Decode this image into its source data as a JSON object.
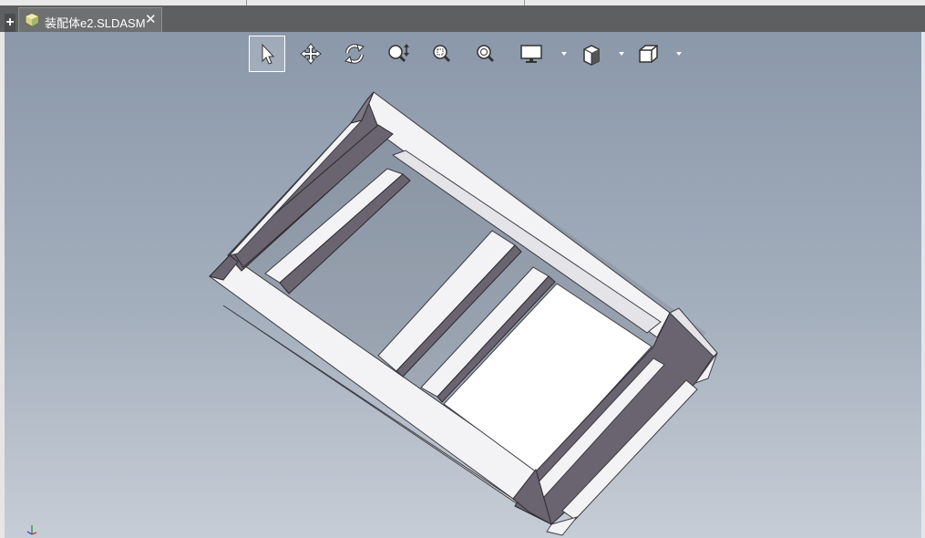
{
  "tabs": {
    "add_label": "+",
    "document": {
      "title": "装配体e2.SLDASM",
      "close_label": "✕",
      "icon": "assembly-icon"
    }
  },
  "toolbar": {
    "items": [
      {
        "name": "select",
        "icon": "pointer-icon",
        "active": true
      },
      {
        "name": "pan",
        "icon": "move-arrows-icon",
        "active": false
      },
      {
        "name": "rotate",
        "icon": "rotate-icon",
        "active": false
      },
      {
        "name": "zoom-in-out",
        "icon": "zoom-in-out-icon",
        "active": false
      },
      {
        "name": "zoom-to-area",
        "icon": "zoom-to-area-icon",
        "active": false
      },
      {
        "name": "zoom-to-fit",
        "icon": "zoom-to-fit-icon",
        "active": false
      },
      {
        "name": "display-style",
        "icon": "monitor-icon",
        "has_dropdown": true
      },
      {
        "name": "hide-show-items",
        "icon": "section-cube-icon",
        "has_dropdown": true
      },
      {
        "name": "view-orientation",
        "icon": "cube-icon",
        "has_dropdown": true
      }
    ]
  },
  "colors": {
    "tab_bar": "#5d5f61",
    "viewport_top": "#8b98a9",
    "viewport_bottom": "#c7cdd6",
    "frame_light": "#f4f4f6",
    "frame_dark": "#6a6470"
  }
}
